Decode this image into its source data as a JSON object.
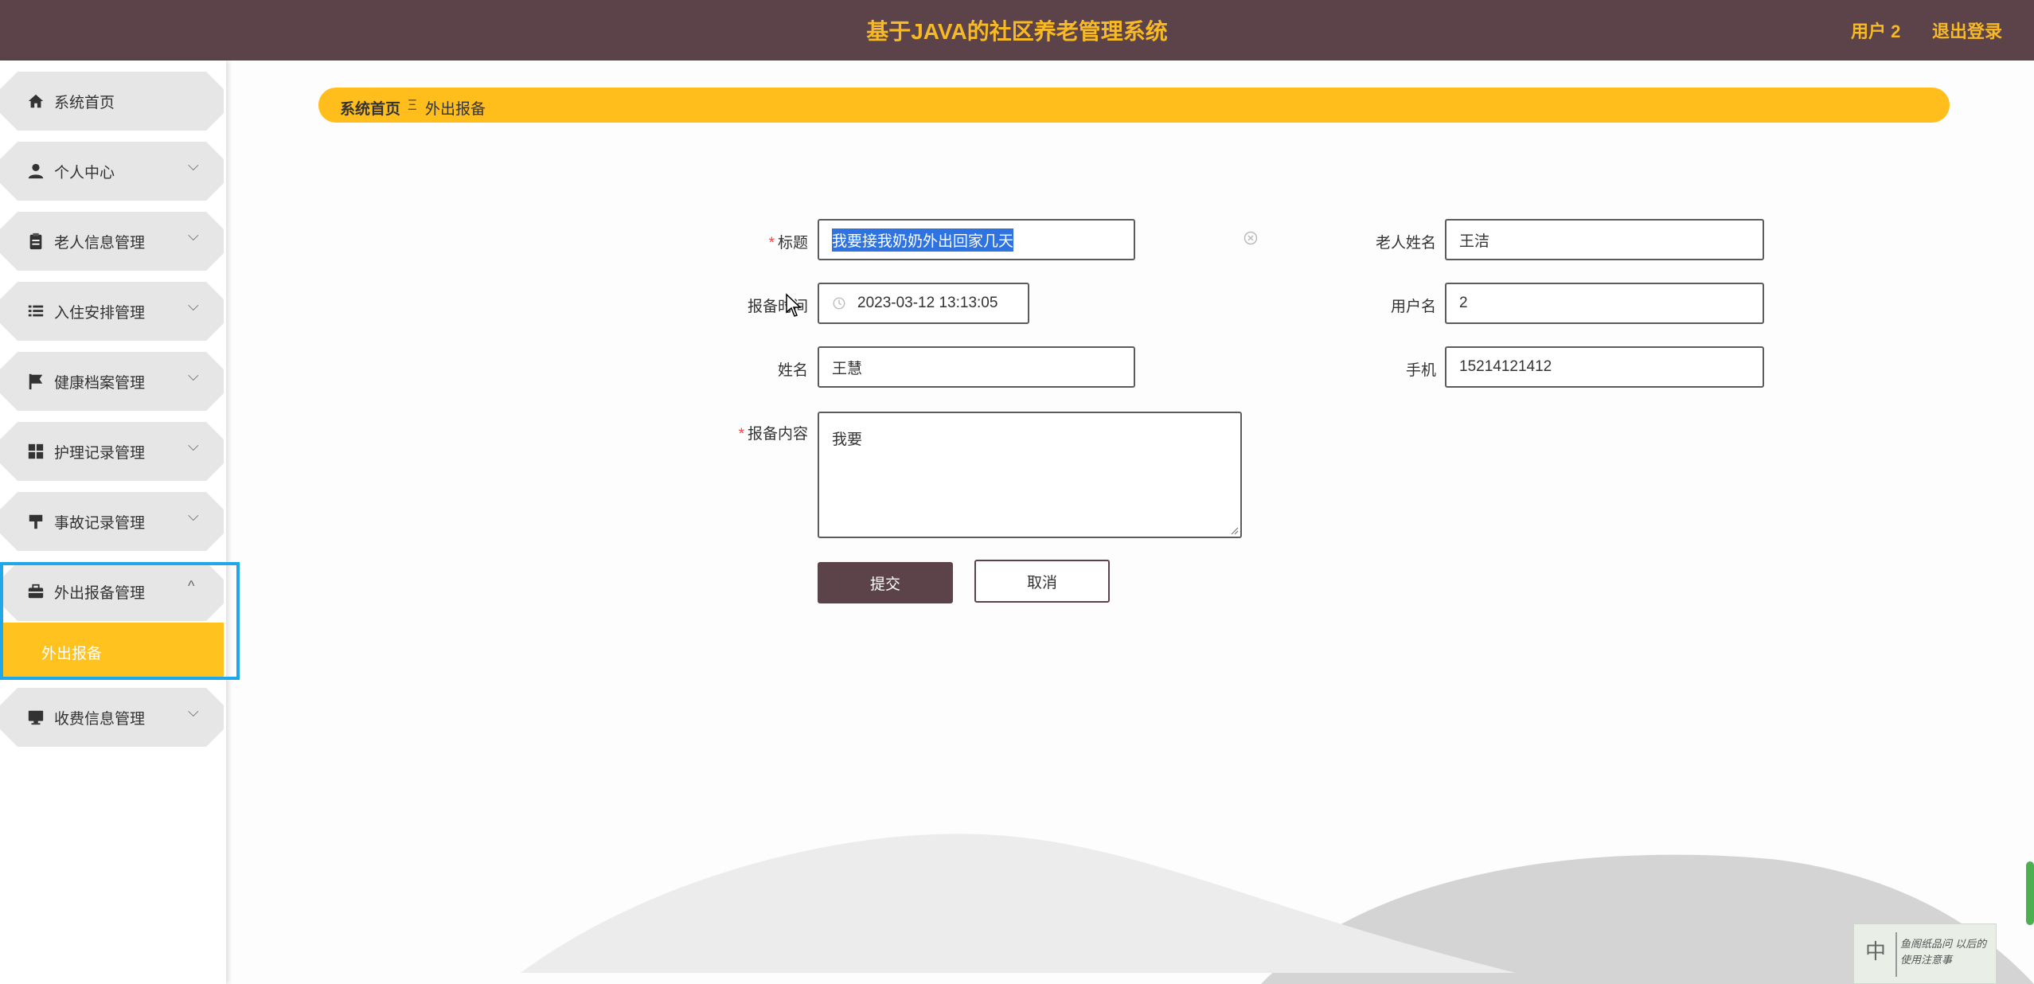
{
  "header": {
    "title": "基于JAVA的社区养老管理系统",
    "user": "用户 2",
    "logout": "退出登录"
  },
  "sidebar": {
    "items": [
      {
        "label": "系统首页",
        "icon": "home-icon",
        "chevron": ""
      },
      {
        "label": "个人中心",
        "icon": "person-icon",
        "chevron": "⌵"
      },
      {
        "label": "老人信息管理",
        "icon": "clipboard-icon",
        "chevron": "⌵"
      },
      {
        "label": "入住安排管理",
        "icon": "list-icon",
        "chevron": "⌵"
      },
      {
        "label": "健康档案管理",
        "icon": "flag-icon",
        "chevron": "⌵"
      },
      {
        "label": "护理记录管理",
        "icon": "grid-icon",
        "chevron": "⌵"
      },
      {
        "label": "事故记录管理",
        "icon": "stamp-icon",
        "chevron": "⌵"
      },
      {
        "label": "外出报备管理",
        "icon": "briefcase-icon",
        "chevron": "^"
      },
      {
        "label": "收费信息管理",
        "icon": "monitor-icon",
        "chevron": "⌵"
      }
    ],
    "active_sub": "外出报备"
  },
  "breadcrumb": {
    "home": "系统首页",
    "separator": "Ξ",
    "current": "外出报备"
  },
  "form": {
    "required_mark": "*",
    "title_label": "标题",
    "title_value": "我要接我奶奶外出回家几天",
    "elder_name_label": "老人姓名",
    "elder_name_value": "王洁",
    "report_time_label": "报备时间",
    "report_time_value": "2023-03-12 13:13:05",
    "username_label": "用户名",
    "username_value": "2",
    "name_label": "姓名",
    "name_value": "王慧",
    "phone_label": "手机",
    "phone_value": "15214121412",
    "content_label": "报备内容",
    "content_value": "我要"
  },
  "buttons": {
    "submit": "提交",
    "cancel": "取消"
  },
  "ime": {
    "mode": "中",
    "text": "鱼阁纸品问 以后的使用注意事"
  },
  "colors": {
    "header_bg": "#5c434a",
    "accent": "#ffbe1c",
    "title_text": "#f7b924",
    "highlight_border": "#1fa7e8"
  }
}
